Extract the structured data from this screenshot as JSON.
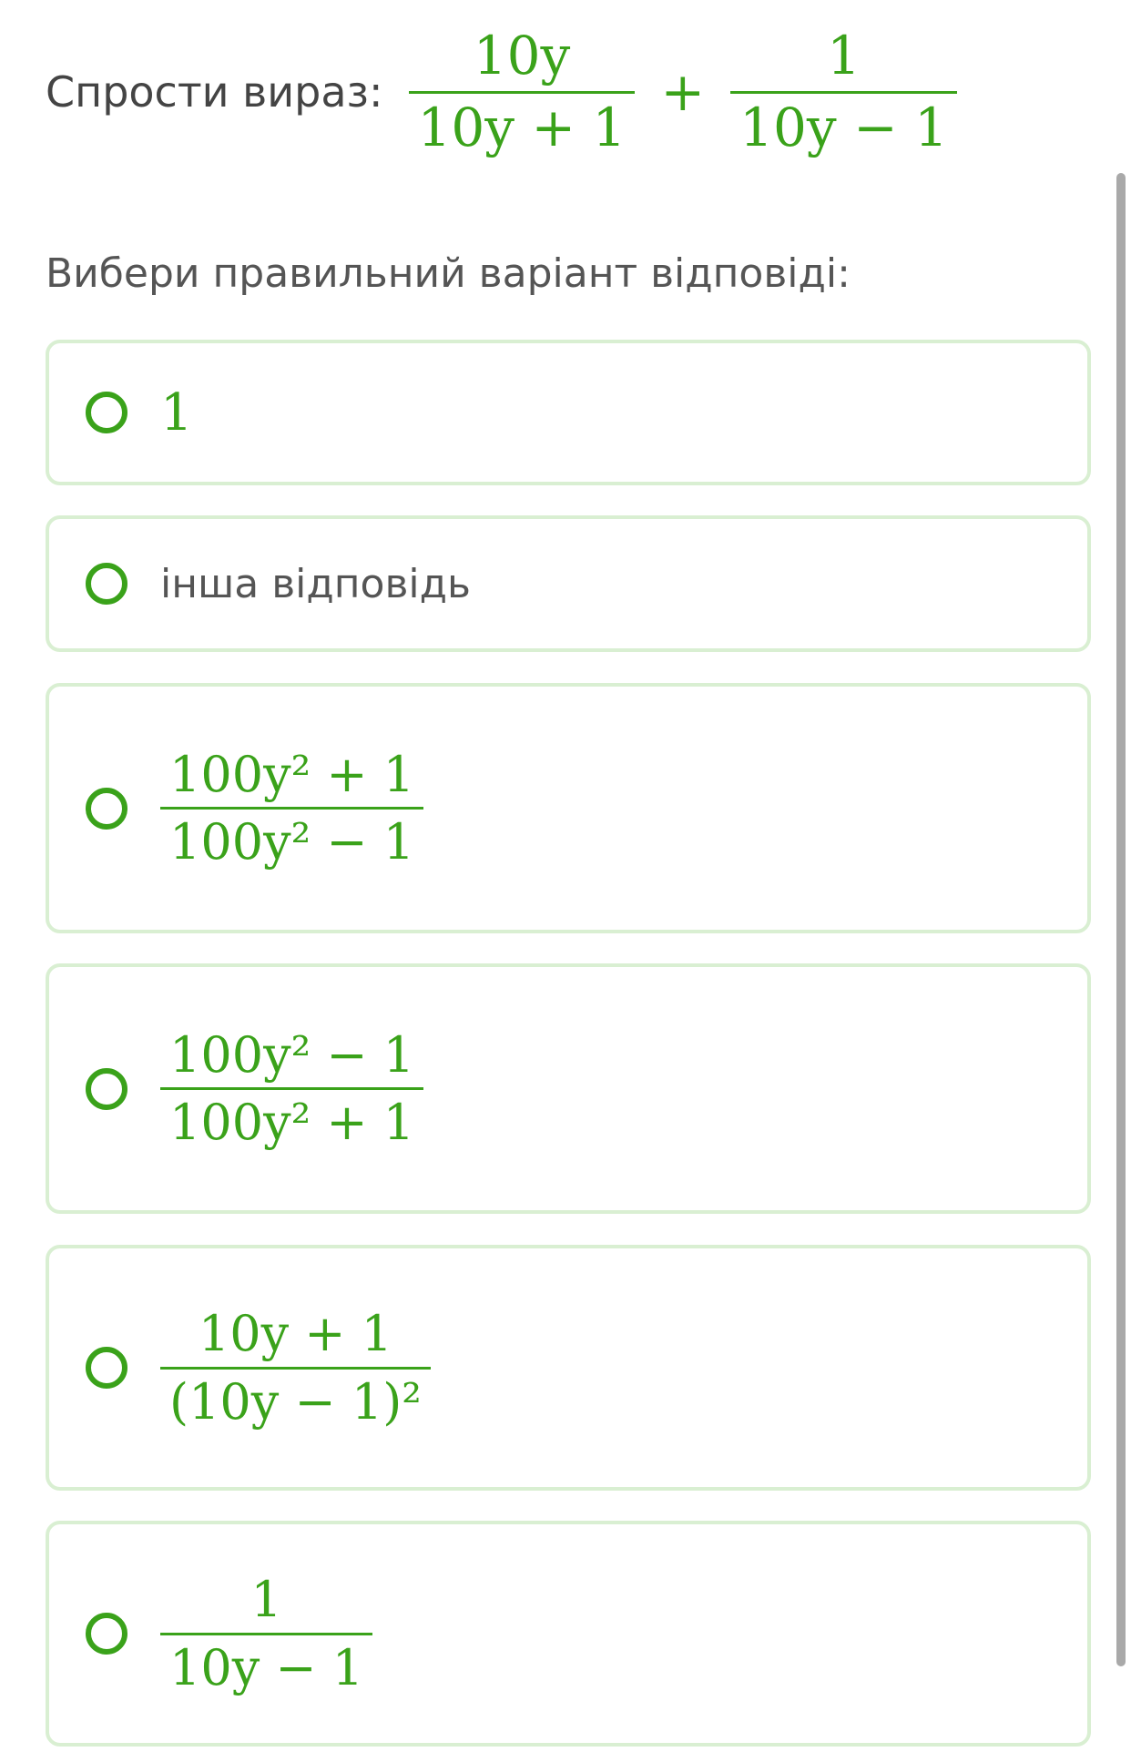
{
  "question": {
    "label": "Спрости вираз:",
    "term1": {
      "num": "10y",
      "den": "10y + 1"
    },
    "operator": "+",
    "term2": {
      "num": "1",
      "den": "10y − 1"
    }
  },
  "instruction": "Вибери правильний варіант відповіді:",
  "options": [
    {
      "type": "math",
      "text": "1"
    },
    {
      "type": "text",
      "text": "інша відповідь"
    },
    {
      "type": "fraction",
      "num": "100y² + 1",
      "den": "100y² − 1"
    },
    {
      "type": "fraction",
      "num": "100y² − 1",
      "den": "100y² + 1"
    },
    {
      "type": "fraction",
      "num": "10y + 1",
      "den": "(10y − 1)²"
    },
    {
      "type": "fraction",
      "num": "1",
      "den": "10y − 1"
    }
  ],
  "colors": {
    "accent": "#3aa21a",
    "option_border": "#d9efd2",
    "text": "#555555"
  }
}
